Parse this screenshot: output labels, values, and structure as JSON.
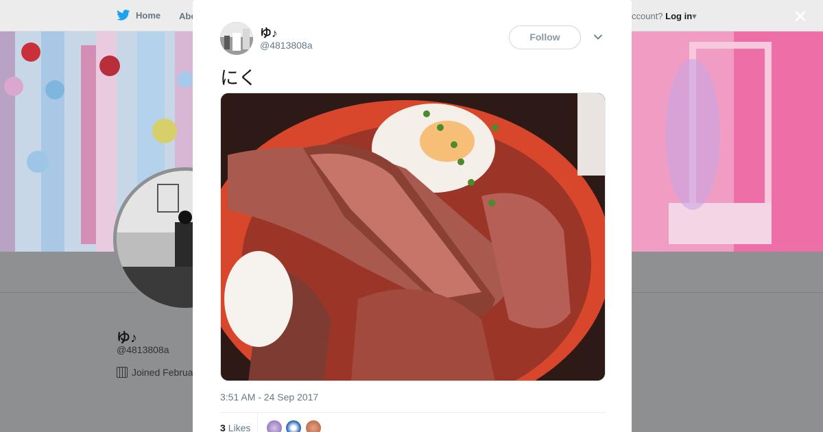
{
  "nav": {
    "home_label": "Home",
    "about_label": "Abo",
    "account_prefix": "ccount?",
    "login_label": "Log in",
    "login_caret": "▾"
  },
  "profile": {
    "name": "ゆ♪",
    "handle": "@4813808a",
    "joined": "Joined Februa"
  },
  "modal": {
    "close_glyph": "✕",
    "user_name": "ゆ♪",
    "user_handle": "@4813808a",
    "follow_label": "Follow",
    "tweet_text": "にく",
    "timestamp": "3:51 AM - 24 Sep 2017",
    "likes_count": "3",
    "likes_label": "Likes"
  },
  "colors": {
    "twitter_blue": "#1da1f2",
    "muted_text": "#657786",
    "follow_border": "#ccd6dd"
  },
  "icons": [
    "twitter-bird-icon",
    "calendar-icon",
    "close-icon",
    "chevron-down-icon"
  ]
}
